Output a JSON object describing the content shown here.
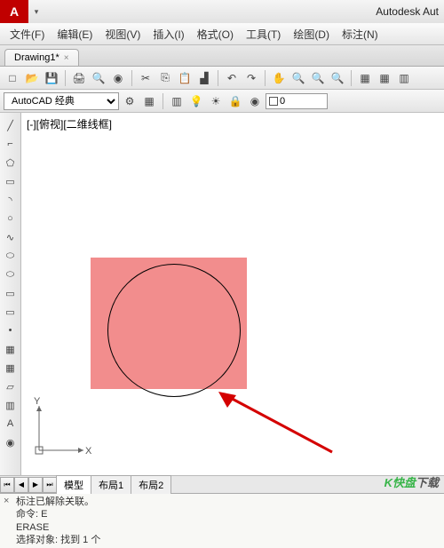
{
  "title": "Autodesk Aut",
  "logo_letter": "A",
  "menus": {
    "file": "文件(F)",
    "edit": "编辑(E)",
    "view": "视图(V)",
    "insert": "插入(I)",
    "format": "格式(O)",
    "tools": "工具(T)",
    "draw": "绘图(D)",
    "annotate": "标注(N)"
  },
  "document_tab": "Drawing1*",
  "workspace": "AutoCAD 经典",
  "layer": {
    "color_swatch": "#ffffff",
    "name": "0"
  },
  "viewport_label": "[-][俯视][二维线框]",
  "ucs": {
    "x": "X",
    "y": "Y"
  },
  "bottom_tabs": {
    "model": "模型",
    "layout1": "布局1",
    "layout2": "布局2"
  },
  "command": {
    "line1": "标注已解除关联。",
    "line2": "命令: E",
    "line3": "ERASE",
    "line4": "选择对象: 找到 1 个"
  },
  "watermark": {
    "brand_k": "K",
    "brand_rest": "快盘",
    "suffix": "下载"
  },
  "icons": {
    "qat_down": "▾",
    "close": "×",
    "new": "□",
    "open": "📂",
    "save": "💾",
    "print": "🖨",
    "preview": "🔍",
    "cut": "✂",
    "copy": "⎘",
    "paste": "📋",
    "undo": "↶",
    "redo": "↷",
    "pan": "✋",
    "zoom": "🔍",
    "gear": "⚙",
    "grid": "▦",
    "bulb": "💡",
    "sun": "☀",
    "lock": "🔒",
    "disk": "◉",
    "line": "╱",
    "polyline": "⌐",
    "polygon": "⬠",
    "rect": "▭",
    "arc": "◝",
    "circle": "○",
    "spline": "∿",
    "ellipse": "⬭",
    "hatch": "▦",
    "point": "•",
    "region": "▱",
    "table": "▥",
    "text": "A",
    "mirror": "▟"
  }
}
